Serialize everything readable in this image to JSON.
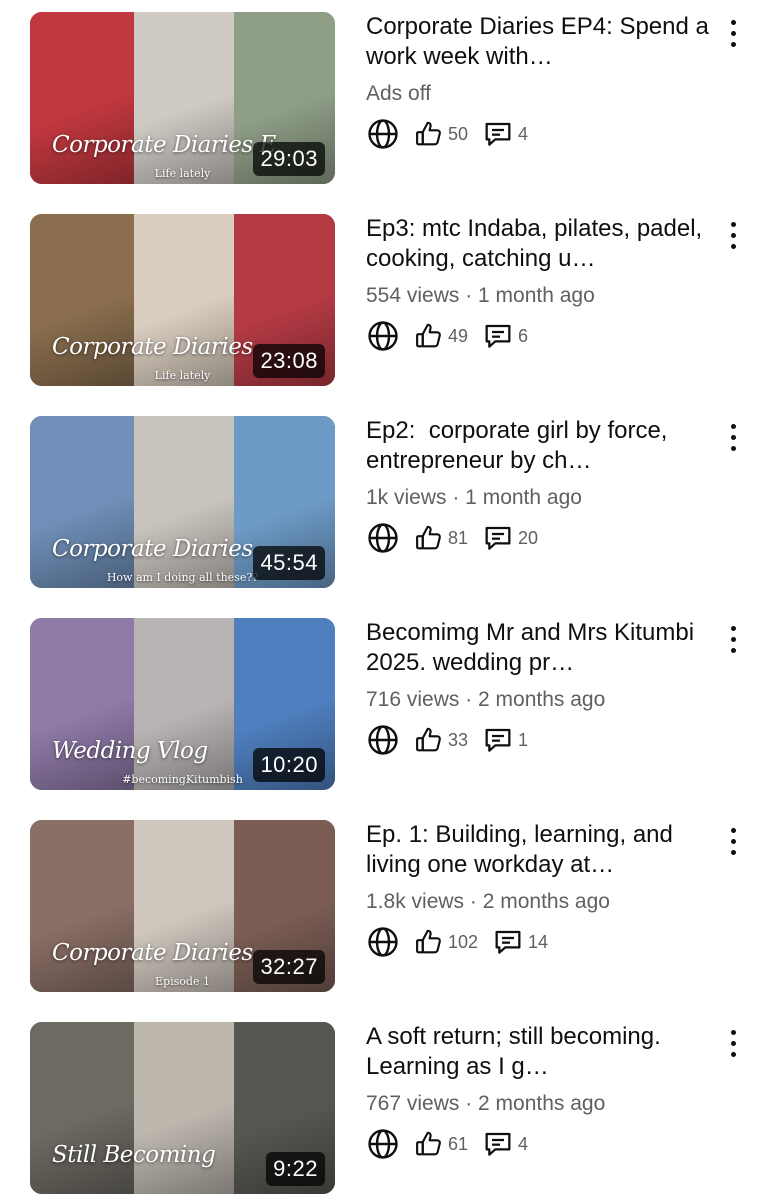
{
  "videos": [
    {
      "title": "Corporate Diaries EP4: Spend a work week with…",
      "meta": "Ads off",
      "likes": "50",
      "comments": "4",
      "duration": "29:03",
      "thumb_title": "Corporate Diaries E",
      "thumb_subtitle": "Life lately",
      "colors": [
        "#c2383f",
        "#cfcac4",
        "#8e9e87"
      ]
    },
    {
      "title": "Ep3: mtc Indaba, pilates, padel, cooking, catching u…",
      "meta": "554 views · 1 month ago",
      "likes": "49",
      "comments": "6",
      "duration": "23:08",
      "thumb_title": "Corporate Diaries",
      "thumb_subtitle": "Life lately",
      "colors": [
        "#8a6e4e",
        "#d9cdbf",
        "#b43a44"
      ]
    },
    {
      "title": "Ep2:  corporate girl by force, entrepreneur by ch…",
      "meta": "1k views · 1 month ago",
      "likes": "81",
      "comments": "20",
      "duration": "45:54",
      "thumb_title": "Corporate Diaries",
      "thumb_subtitle": "How am I doing all these??",
      "colors": [
        "#6f8fb8",
        "#c9c3bd",
        "#6d9ac6"
      ]
    },
    {
      "title": "Becomimg Mr and Mrs Kitumbi 2025. wedding pr…",
      "meta": "716 views · 2 months ago",
      "likes": "33",
      "comments": "1",
      "duration": "10:20",
      "thumb_title": "Wedding Vlog",
      "thumb_subtitle": "#becomingKitumbish",
      "colors": [
        "#8f7aa8",
        "#b9b4b4",
        "#4f7fbf"
      ]
    },
    {
      "title": "Ep. 1: Building, learning, and living one workday at…",
      "meta": "1.8k views · 2 months ago",
      "likes": "102",
      "comments": "14",
      "duration": "32:27",
      "thumb_title": "Corporate Diaries",
      "thumb_subtitle": "Episode 1",
      "colors": [
        "#8a6f66",
        "#cfc6bd",
        "#7b5d55"
      ]
    },
    {
      "title": "A soft return; still becoming. Learning as I g…",
      "meta": "767 views · 2 months ago",
      "likes": "61",
      "comments": "4",
      "duration": "9:22",
      "thumb_title": "Still Becoming",
      "thumb_subtitle": "",
      "colors": [
        "#6d6a62",
        "#bdb7ae",
        "#565751"
      ]
    }
  ]
}
